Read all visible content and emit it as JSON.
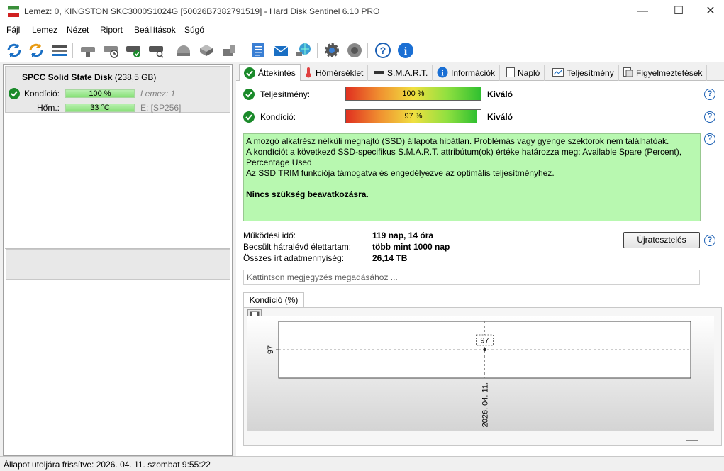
{
  "window": {
    "title": "Lemez: 0, KINGSTON SKC3000S1024G [50026B7382791519]  -  Hard Disk Sentinel 6.10 PRO",
    "minimize": "—",
    "maximize": "☐",
    "close": "✕"
  },
  "menu": [
    "Fájl",
    "Lemez",
    "Nézet",
    "Riport",
    "Beállítások",
    "Súgó"
  ],
  "toolbar": {
    "icons": [
      "refresh-icon",
      "refresh-all-icon",
      "disk-list-icon",
      "disk-info-icon",
      "disk-schedule-icon",
      "disk-ok-icon",
      "disk-search-icon",
      "disk-surface-icon",
      "disk-transfer-icon",
      "usb-disk-icon",
      "report-icon",
      "email-icon",
      "network-icon",
      "settings-icon",
      "sound-icon",
      "help-icon",
      "info-icon"
    ]
  },
  "left": {
    "disk_name": "SPCC Solid State Disk",
    "disk_size": "(238,5 GB)",
    "condition_label": "Kondíció:",
    "condition_value": "100 %",
    "condition_pct": 100,
    "disk_index": "Lemez: 1",
    "temp_label": "Hőm.:",
    "temp_value": "33 °C",
    "partition": "E: [SP256]"
  },
  "tabs": [
    {
      "label": "Áttekintés",
      "icon": "check-icon"
    },
    {
      "label": "Hőmérséklet",
      "icon": "thermometer-icon"
    },
    {
      "label": "S.M.A.R.T.",
      "icon": "disk-icon"
    },
    {
      "label": "Információk",
      "icon": "info-icon"
    },
    {
      "label": "Napló",
      "icon": "log-icon"
    },
    {
      "label": "Teljesítmény",
      "icon": "performance-icon"
    },
    {
      "label": "Figyelmeztetések",
      "icon": "alerts-icon"
    }
  ],
  "overview": {
    "performance_label": "Teljesítmény:",
    "performance_value": "100 %",
    "performance_pct": 100,
    "performance_rating": "Kiváló",
    "health_label": "Kondíció:",
    "health_value": "97 %",
    "health_pct": 97,
    "health_rating": "Kiváló",
    "message_lines": [
      "A mozgó alkatrész nélküli meghajtó (SSD) állapota hibátlan. Problémás vagy gyenge szektorok nem találhatóak.",
      "A kondíciót a következő SSD-specifikus S.M.A.R.T. attribútum(ok) értéke határozza meg:  Available Spare (Percent), Percentage Used",
      "Az SSD TRIM funkciója támogatva és engedélyezve az optimális teljesítményhez."
    ],
    "message_bold": "Nincs szükség beavatkozásra.",
    "uptime_label": "Működési idő:",
    "uptime_value": "119 nap, 14 óra",
    "lifetime_label": "Becsült hátralévő élettartam:",
    "lifetime_value": "több mint 1000 nap",
    "written_label": "Összes írt adatmennyiség:",
    "written_value": "26,14 TB",
    "retest_button": "Újratesztelés",
    "note_placeholder": "Kattintson megjegyzés megadásához ..."
  },
  "chart_tab": "Kondíció  (%)",
  "chart_data": {
    "type": "line",
    "title": "",
    "x": [
      "2026. 04. 11."
    ],
    "series": [
      {
        "values": [
          97
        ]
      }
    ],
    "ylabel": "",
    "y_tick_labels": [
      "97"
    ],
    "data_labels": [
      "97"
    ],
    "grid": true
  },
  "status": {
    "text": "Állapot utoljára frissítve: 2026. 04. 11. szombat 9:55:22"
  }
}
